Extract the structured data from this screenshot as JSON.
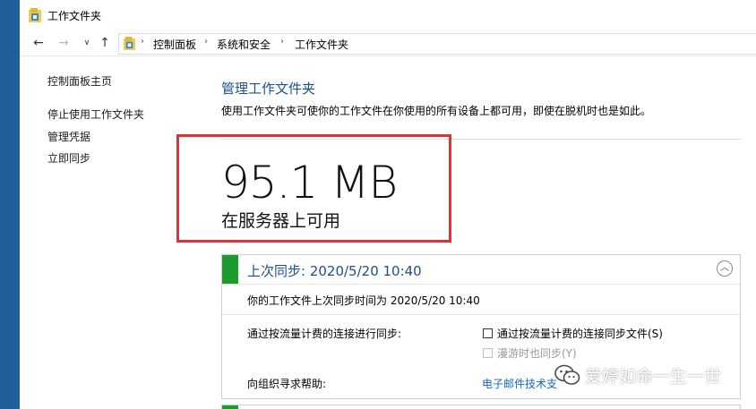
{
  "window": {
    "title": "工作文件夹"
  },
  "address": {
    "crumbs": [
      "控制面板",
      "系统和安全",
      "工作文件夹"
    ]
  },
  "nav": {
    "back": "←",
    "forward": "→",
    "recent": "∨",
    "up": "↑"
  },
  "sidebar": {
    "items": [
      {
        "label": "控制面板主页"
      },
      {
        "label": "停止使用工作文件夹"
      },
      {
        "label": "管理凭据"
      },
      {
        "label": "立即同步"
      }
    ]
  },
  "main": {
    "heading": "管理工作文件夹",
    "description": "使用工作文件夹可使你的工作文件在你使用的所有设备上都可用，即使在脱机时也是如此。",
    "storage": {
      "value": "95.1 MB",
      "label": "在服务器上可用"
    }
  },
  "sync_panel": {
    "title": "上次同步: 2020/5/20 10:40",
    "collapse_glyph": "︿",
    "detail": "你的工作文件上次同步时间为 2020/5/20 10:40",
    "metered_label": "通过按流量计费的连接进行同步:",
    "metered_checkbox": "通过按流量计费的连接同步文件(S)",
    "roaming_checkbox": "漫游时也同步(Y)",
    "help_label": "向组织寻求帮助:",
    "help_link": "电子邮件技术支"
  },
  "watermark": {
    "text": "爱婷如命一生一世"
  },
  "colors": {
    "accent_blue": "#1e4e8c",
    "sync_green": "#1d9b2c",
    "highlight_red": "#d9343c",
    "link": "#1565c0"
  },
  "icons": [
    "folder-icon",
    "back-arrow-icon",
    "forward-arrow-icon",
    "chevron-down-icon",
    "up-arrow-icon",
    "chevron-up-icon",
    "wechat-icon"
  ]
}
